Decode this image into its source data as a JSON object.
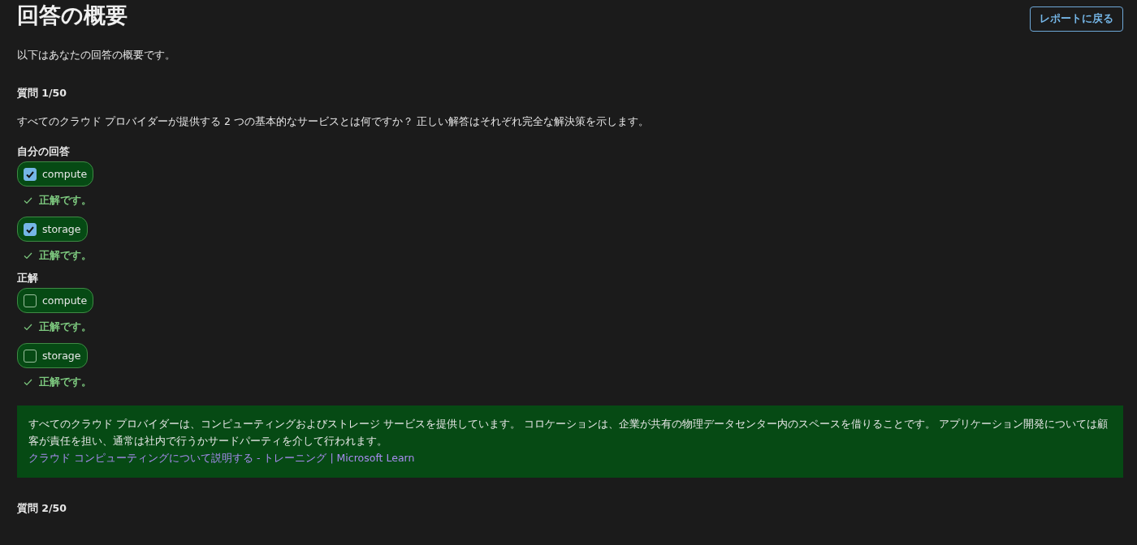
{
  "title": "回答の概要",
  "back_button": "レポートに戻る",
  "intro": "以下はあなたの回答の概要です。",
  "questions": [
    {
      "label": "質問 1/50",
      "text": "すべてのクラウド プロバイダーが提供する 2 つの基本的なサービスとは何ですか？ 正しい解答はそれぞれ完全な解決策を示します。",
      "your_answer_heading": "自分の回答",
      "your_answers": [
        {
          "label": "compute",
          "checked": true,
          "feedback": "正解です。"
        },
        {
          "label": "storage",
          "checked": true,
          "feedback": "正解です。"
        }
      ],
      "correct_heading": "正解",
      "correct_answers": [
        {
          "label": "compute",
          "checked": false,
          "feedback": "正解です。"
        },
        {
          "label": "storage",
          "checked": false,
          "feedback": "正解です。"
        }
      ],
      "explanation": "すべてのクラウド プロバイダーは、コンピューティングおよびストレージ サービスを提供しています。 コロケーションは、企業が共有の物理データセンター内のスペースを借りることです。 アプリケーション開発については顧客が責任を担い、通常は社内で行うかサードパーティを介して行われます。",
      "link": "クラウド コンピューティングについて説明する - トレーニング | Microsoft Learn"
    },
    {
      "label": "質問 2/50"
    }
  ]
}
